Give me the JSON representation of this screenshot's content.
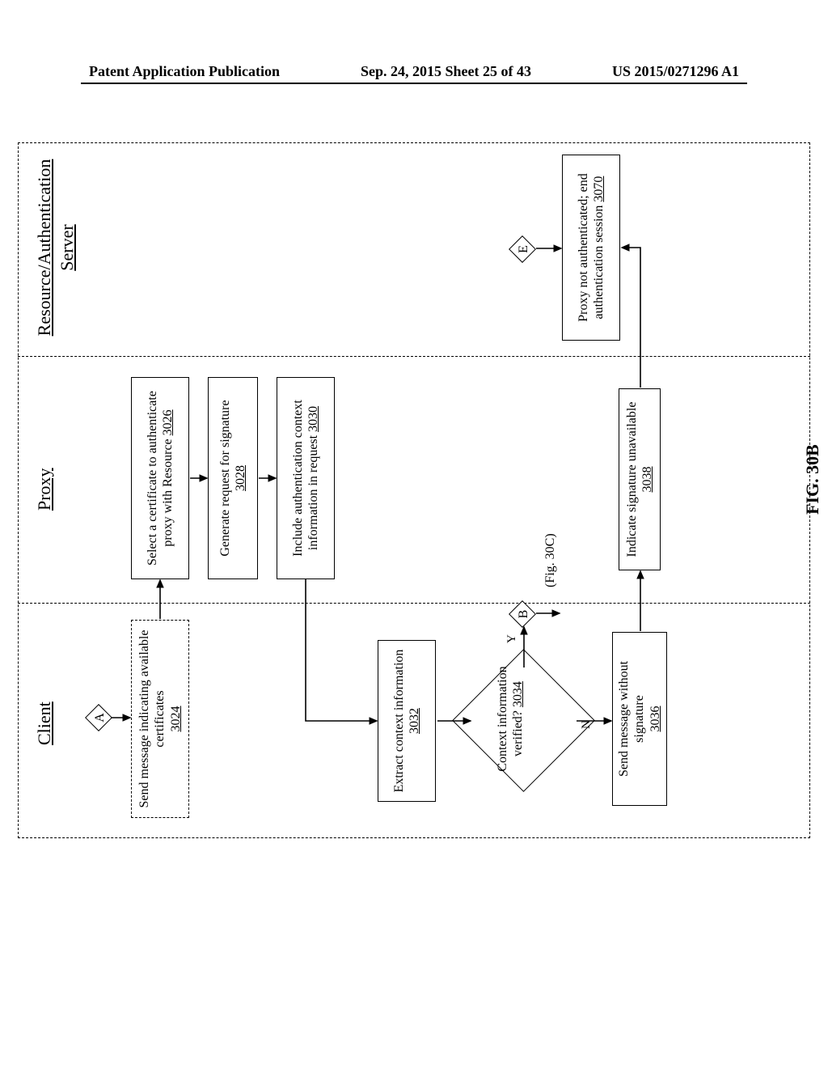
{
  "header": {
    "left": "Patent Application Publication",
    "center": "Sep. 24, 2015  Sheet 25 of 43",
    "right": "US 2015/0271296 A1"
  },
  "lanes": {
    "client": "Client",
    "proxy": "Proxy",
    "ra1": "Resource/Authentication",
    "ra2": "Server"
  },
  "connectors": {
    "a": "A",
    "b": "B",
    "e": "E"
  },
  "yn": {
    "y": "Y",
    "n": "N"
  },
  "boxes": {
    "b3024": "Send message indicating available certificates",
    "b3024_ref": "3024",
    "b3026": "Select a certificate to authenticate proxy with Resource",
    "b3026_ref": "3026",
    "b3028": "Generate request for signature",
    "b3028_ref": "3028",
    "b3030": "Include authentication context information in request",
    "b3030_ref": "3030",
    "b3032": "Extract context information",
    "b3032_ref": "3032",
    "b3034": "Context information verified?",
    "b3034_ref": "3034",
    "b3036": "Send message without signature",
    "b3036_ref": "3036",
    "b3038": "Indicate signature unavailable",
    "b3038_ref": "3038",
    "b3070": "Proxy not authenticated; end authentication session",
    "b3070_ref": "3070"
  },
  "fig30c": "(Fig. 30C)",
  "caption": "FIG. 30B"
}
